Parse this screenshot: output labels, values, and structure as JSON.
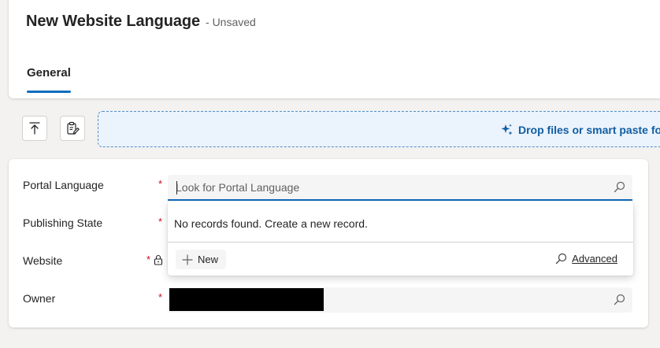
{
  "header": {
    "title": "New Website Language",
    "status": "- Unsaved"
  },
  "tabs": [
    {
      "label": "General",
      "selected": true
    }
  ],
  "toolbar": {
    "drop_text": "Drop files or smart paste for"
  },
  "form": {
    "fields": [
      {
        "label": "Portal Language",
        "required": true,
        "placeholder": "Look for Portal Language"
      },
      {
        "label": "Publishing State",
        "required": true
      },
      {
        "label": "Website",
        "required": true,
        "locked": true
      },
      {
        "label": "Owner",
        "required": true,
        "value_redacted": true
      }
    ],
    "required_marker": "*"
  },
  "lookup_flyout": {
    "message": "No records found. Create a new record.",
    "new_label": "New",
    "advanced_label": "Advanced"
  },
  "colors": {
    "accent": "#0f6cbd",
    "link": "#115ea3",
    "required": "#c50f1f",
    "drop_zone_bg": "#ebf3fc"
  },
  "icons": {
    "upload": "arrow-up-to-line-icon",
    "smart_paste": "clipboard-edit-icon",
    "sparkle": "sparkle-icon",
    "search": "search-icon",
    "add": "plus-icon",
    "lock": "lock-icon"
  }
}
